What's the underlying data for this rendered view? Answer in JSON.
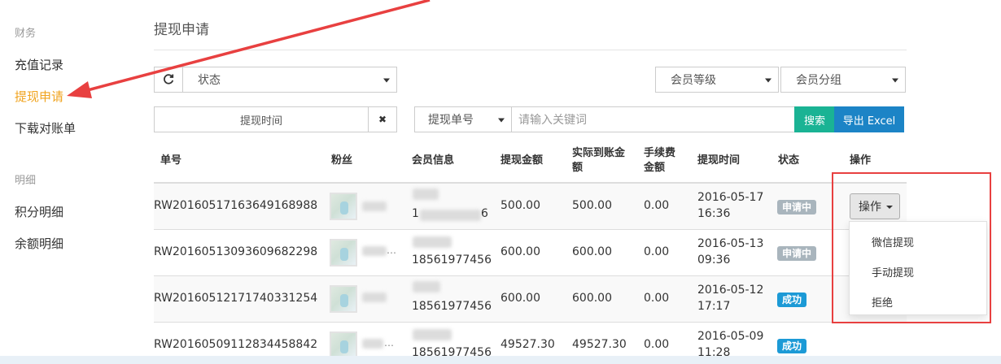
{
  "sidebar": {
    "section_finance": "财务",
    "items": [
      {
        "label": "充值记录"
      },
      {
        "label": "提现申请"
      },
      {
        "label": "下载对账单"
      }
    ],
    "section_detail": "明细",
    "items2": [
      {
        "label": "积分明细"
      },
      {
        "label": "余额明细"
      }
    ]
  },
  "main": {
    "title": "提现申请"
  },
  "filters": {
    "status": "状态",
    "member_level": "会员等级",
    "member_group": "会员分组",
    "withdraw_time_placeholder": "提现时间",
    "clear_symbol": "✖",
    "order_no": "提现单号",
    "keyword_placeholder": "请输入关键词",
    "search": "搜索",
    "export": "导出 Excel",
    "refresh_icon": "refresh-icon"
  },
  "table": {
    "headers": {
      "order_no": "单号",
      "fan": "粉丝",
      "member": "会员信息",
      "amount": "提现金额",
      "actual_1": "实际到账金",
      "actual_2": "额",
      "fee_1": "手续费",
      "fee_2": "金额",
      "time": "提现时间",
      "status": "状态",
      "action": "操作"
    },
    "rows": [
      {
        "order_no": "RW20160517163649168988",
        "fan_fragment": "",
        "phone": "1",
        "phone_tail": "6",
        "amount": "500.00",
        "actual": "500.00",
        "fee": "0.00",
        "date": "2016-05-17",
        "time": "16:36",
        "status": "申请中"
      },
      {
        "order_no": "RW20160513093609682298",
        "fan_fragment": "…",
        "phone": "18561977456",
        "phone_tail": "",
        "amount": "600.00",
        "actual": "600.00",
        "fee": "0.00",
        "date": "2016-05-13",
        "time": "09:36",
        "status": "申请中"
      },
      {
        "order_no": "RW20160512171740331254",
        "fan_fragment": "",
        "phone": "18561977456",
        "phone_tail": "",
        "amount": "600.00",
        "actual": "600.00",
        "fee": "0.00",
        "date": "2016-05-12",
        "time": "17:17",
        "status": "成功"
      },
      {
        "order_no": "RW20160509112834458842",
        "fan_fragment": "…",
        "phone": "18561977456",
        "phone_tail": "",
        "amount": "49527.30",
        "actual": "49527.30",
        "fee": "0.00",
        "date": "2016-05-09",
        "time": "11:28",
        "status": "成功"
      }
    ]
  },
  "action_menu": {
    "button": "操作",
    "items": [
      {
        "label": "微信提现"
      },
      {
        "label": "手动提现"
      },
      {
        "label": "拒绝"
      }
    ]
  },
  "colors": {
    "accent_orange": "#f0a31e",
    "search_green": "#1ab394",
    "export_blue": "#1c84c6",
    "annotation_red": "#e84040",
    "badge_pending": "#a9b5bd",
    "badge_success": "#1c9ad6"
  }
}
